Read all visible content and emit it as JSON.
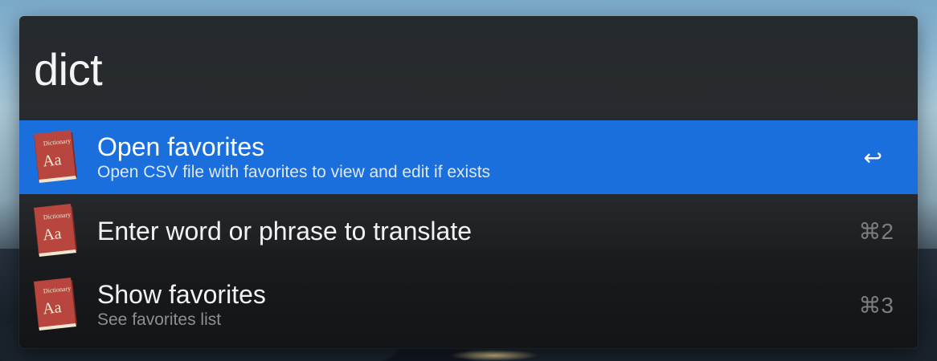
{
  "search": {
    "query": "dict"
  },
  "results": [
    {
      "title": "Open favorites",
      "subtitle": "Open CSV file with favorites to view and edit if exists",
      "shortcut": "↩",
      "selected": true,
      "icon": "dictionary-app-icon"
    },
    {
      "title": "Enter word or phrase to translate",
      "subtitle": "",
      "shortcut": "⌘2",
      "selected": false,
      "icon": "dictionary-app-icon"
    },
    {
      "title": "Show favorites",
      "subtitle": "See favorites list",
      "shortcut": "⌘3",
      "selected": false,
      "icon": "dictionary-app-icon"
    }
  ],
  "icon_text": {
    "book_label": "Dictionary",
    "book_glyph": "Aa"
  },
  "colors": {
    "selection": "#1a6fdc",
    "panel": "#1e1f21",
    "book_red": "#b8463f"
  }
}
